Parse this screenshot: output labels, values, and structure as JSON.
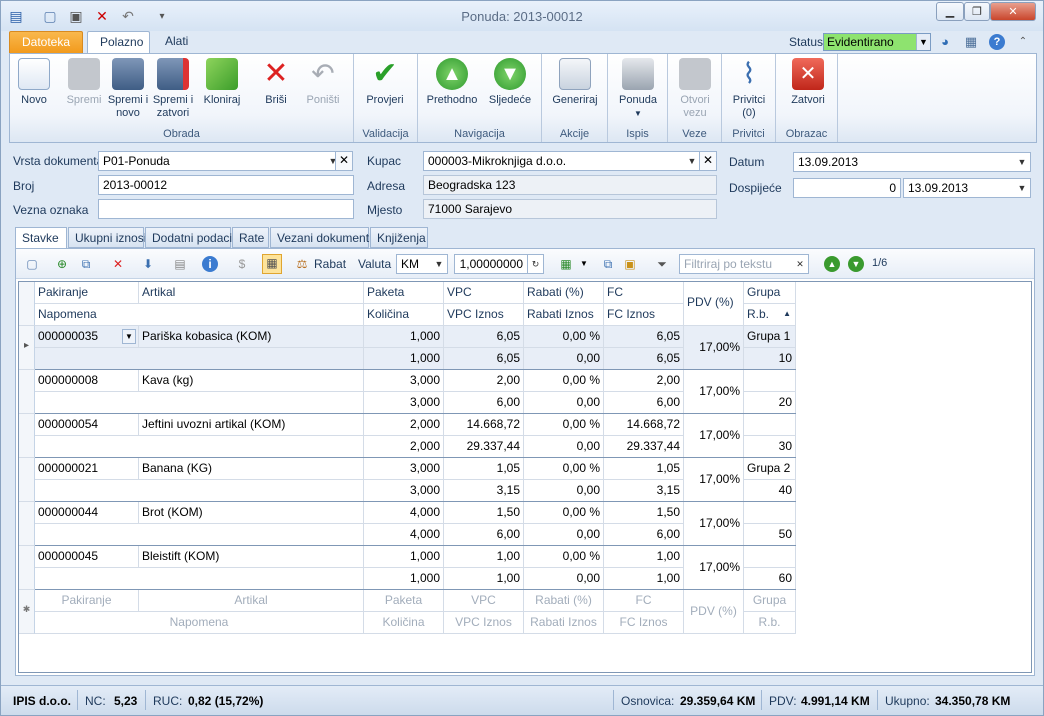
{
  "window": {
    "title": "Ponuda: 2013-00012"
  },
  "ribbon_tabs": [
    "Datoteka",
    "Polazno",
    "Alati"
  ],
  "status": {
    "label": "Status",
    "value": "Evidentirano"
  },
  "ribbon": {
    "groups": {
      "obrada": "Obrada",
      "validacija": "Validacija",
      "navigacija": "Navigacija",
      "akcije": "Akcije",
      "ispis": "Ispis",
      "veze": "Veze",
      "privitci": "Privitci",
      "obrazac": "Obrazac"
    },
    "buttons": {
      "novo": "Novo",
      "spremi": "Spremi",
      "spremi_novo": "Spremi i novo",
      "spremi_zatvori": "Spremi i zatvori",
      "kloniraj": "Kloniraj",
      "brisi": "Briši",
      "ponisti": "Poništi",
      "provjeri": "Provjeri",
      "prethodno": "Prethodno",
      "sljedece": "Sljedeće",
      "generiraj": "Generiraj",
      "ponuda": "Ponuda",
      "otvori_vezu": "Otvori vezu",
      "privitci": "Privitci (0)",
      "zatvori": "Zatvori"
    }
  },
  "form": {
    "vrsta_label": "Vrsta dokumenta",
    "vrsta_value": "P01-Ponuda",
    "broj_label": "Broj",
    "broj_value": "2013-00012",
    "vezna_label": "Vezna oznaka",
    "vezna_value": "",
    "kupac_label": "Kupac",
    "kupac_value": "000003-Mikroknjiga d.o.o.",
    "adresa_label": "Adresa",
    "adresa_value": "Beogradska 123",
    "mjesto_label": "Mjesto",
    "mjesto_value": "71000 Sarajevo",
    "datum_label": "Datum",
    "datum_value": "13.09.2013",
    "dospijece_label": "Dospijeće",
    "dospijece_days": "0",
    "dospijece_date": "13.09.2013"
  },
  "doc_tabs": [
    "Stavke",
    "Ukupni iznosi",
    "Dodatni podaci",
    "Rate",
    "Vezani dokumenti",
    "Knjiženja"
  ],
  "toolbar": {
    "rabat": "Rabat",
    "valuta_label": "Valuta",
    "valuta_value": "KM",
    "tecaj": "1,00000000",
    "filter_placeholder": "Filtriraj po tekstu",
    "page": "1/6"
  },
  "grid": {
    "headers_top": [
      "Pakiranje",
      "Artikal",
      "Paketa",
      "VPC",
      "Rabati (%)",
      "FC",
      "PDV (%)",
      "Grupa"
    ],
    "headers_bottom": [
      "Napomena",
      "Količina",
      "VPC Iznos",
      "Rabati Iznos",
      "FC Iznos",
      "R.b."
    ],
    "rows": [
      {
        "pak": "000000035",
        "art": "Pariška kobasica (KOM)",
        "paketa": "1,000",
        "vpc": "6,05",
        "rabat": "0,00 %",
        "fc": "6,05",
        "kol": "1,000",
        "vpci": "6,05",
        "rabi": "0,00",
        "fci": "6,05",
        "pdv": "17,00%",
        "grupa": "Grupa 1",
        "rb": "10"
      },
      {
        "pak": "000000008",
        "art": "Kava (kg)",
        "paketa": "3,000",
        "vpc": "2,00",
        "rabat": "0,00 %",
        "fc": "2,00",
        "kol": "3,000",
        "vpci": "6,00",
        "rabi": "0,00",
        "fci": "6,00",
        "pdv": "17,00%",
        "grupa": "",
        "rb": "20"
      },
      {
        "pak": "000000054",
        "art": "Jeftini uvozni artikal (KOM)",
        "paketa": "2,000",
        "vpc": "14.668,72",
        "rabat": "0,00 %",
        "fc": "14.668,72",
        "kol": "2,000",
        "vpci": "29.337,44",
        "rabi": "0,00",
        "fci": "29.337,44",
        "pdv": "17,00%",
        "grupa": "",
        "rb": "30"
      },
      {
        "pak": "000000021",
        "art": "Banana (KG)",
        "paketa": "3,000",
        "vpc": "1,05",
        "rabat": "0,00 %",
        "fc": "1,05",
        "kol": "3,000",
        "vpci": "3,15",
        "rabi": "0,00",
        "fci": "3,15",
        "pdv": "17,00%",
        "grupa": "Grupa 2",
        "rb": "40"
      },
      {
        "pak": "000000044",
        "art": "Brot (KOM)",
        "paketa": "4,000",
        "vpc": "1,50",
        "rabat": "0,00 %",
        "fc": "1,50",
        "kol": "4,000",
        "vpci": "6,00",
        "rabi": "0,00",
        "fci": "6,00",
        "pdv": "17,00%",
        "grupa": "",
        "rb": "50"
      },
      {
        "pak": "000000045",
        "art": "Bleistift (KOM)",
        "paketa": "1,000",
        "vpc": "1,00",
        "rabat": "0,00 %",
        "fc": "1,00",
        "kol": "1,000",
        "vpci": "1,00",
        "rabi": "0,00",
        "fci": "1,00",
        "pdv": "17,00%",
        "grupa": "",
        "rb": "60"
      }
    ],
    "new_row": {
      "top": [
        "Pakiranje",
        "Artikal",
        "Paketa",
        "VPC",
        "Rabati (%)",
        "FC",
        "PDV (%)",
        "Grupa"
      ],
      "bottom": [
        "Napomena",
        "Količina",
        "VPC Iznos",
        "Rabati Iznos",
        "FC Iznos",
        "R.b."
      ]
    }
  },
  "statusbar": {
    "company": "IPIS d.o.o.",
    "nc_label": "NC:",
    "nc_value": "5,23",
    "ruc_label": "RUC:",
    "ruc_value": "0,82 (15,72%)",
    "osnovica_label": "Osnovica:",
    "osnovica_value": "29.359,64 KM",
    "pdv_label": "PDV:",
    "pdv_value": "4.991,14 KM",
    "ukupno_label": "Ukupno:",
    "ukupno_value": "34.350,78 KM"
  },
  "colors": {
    "status_green": "#8ee36f",
    "file_tab": "#f29a1c",
    "accent_blue": "#1e395b"
  }
}
